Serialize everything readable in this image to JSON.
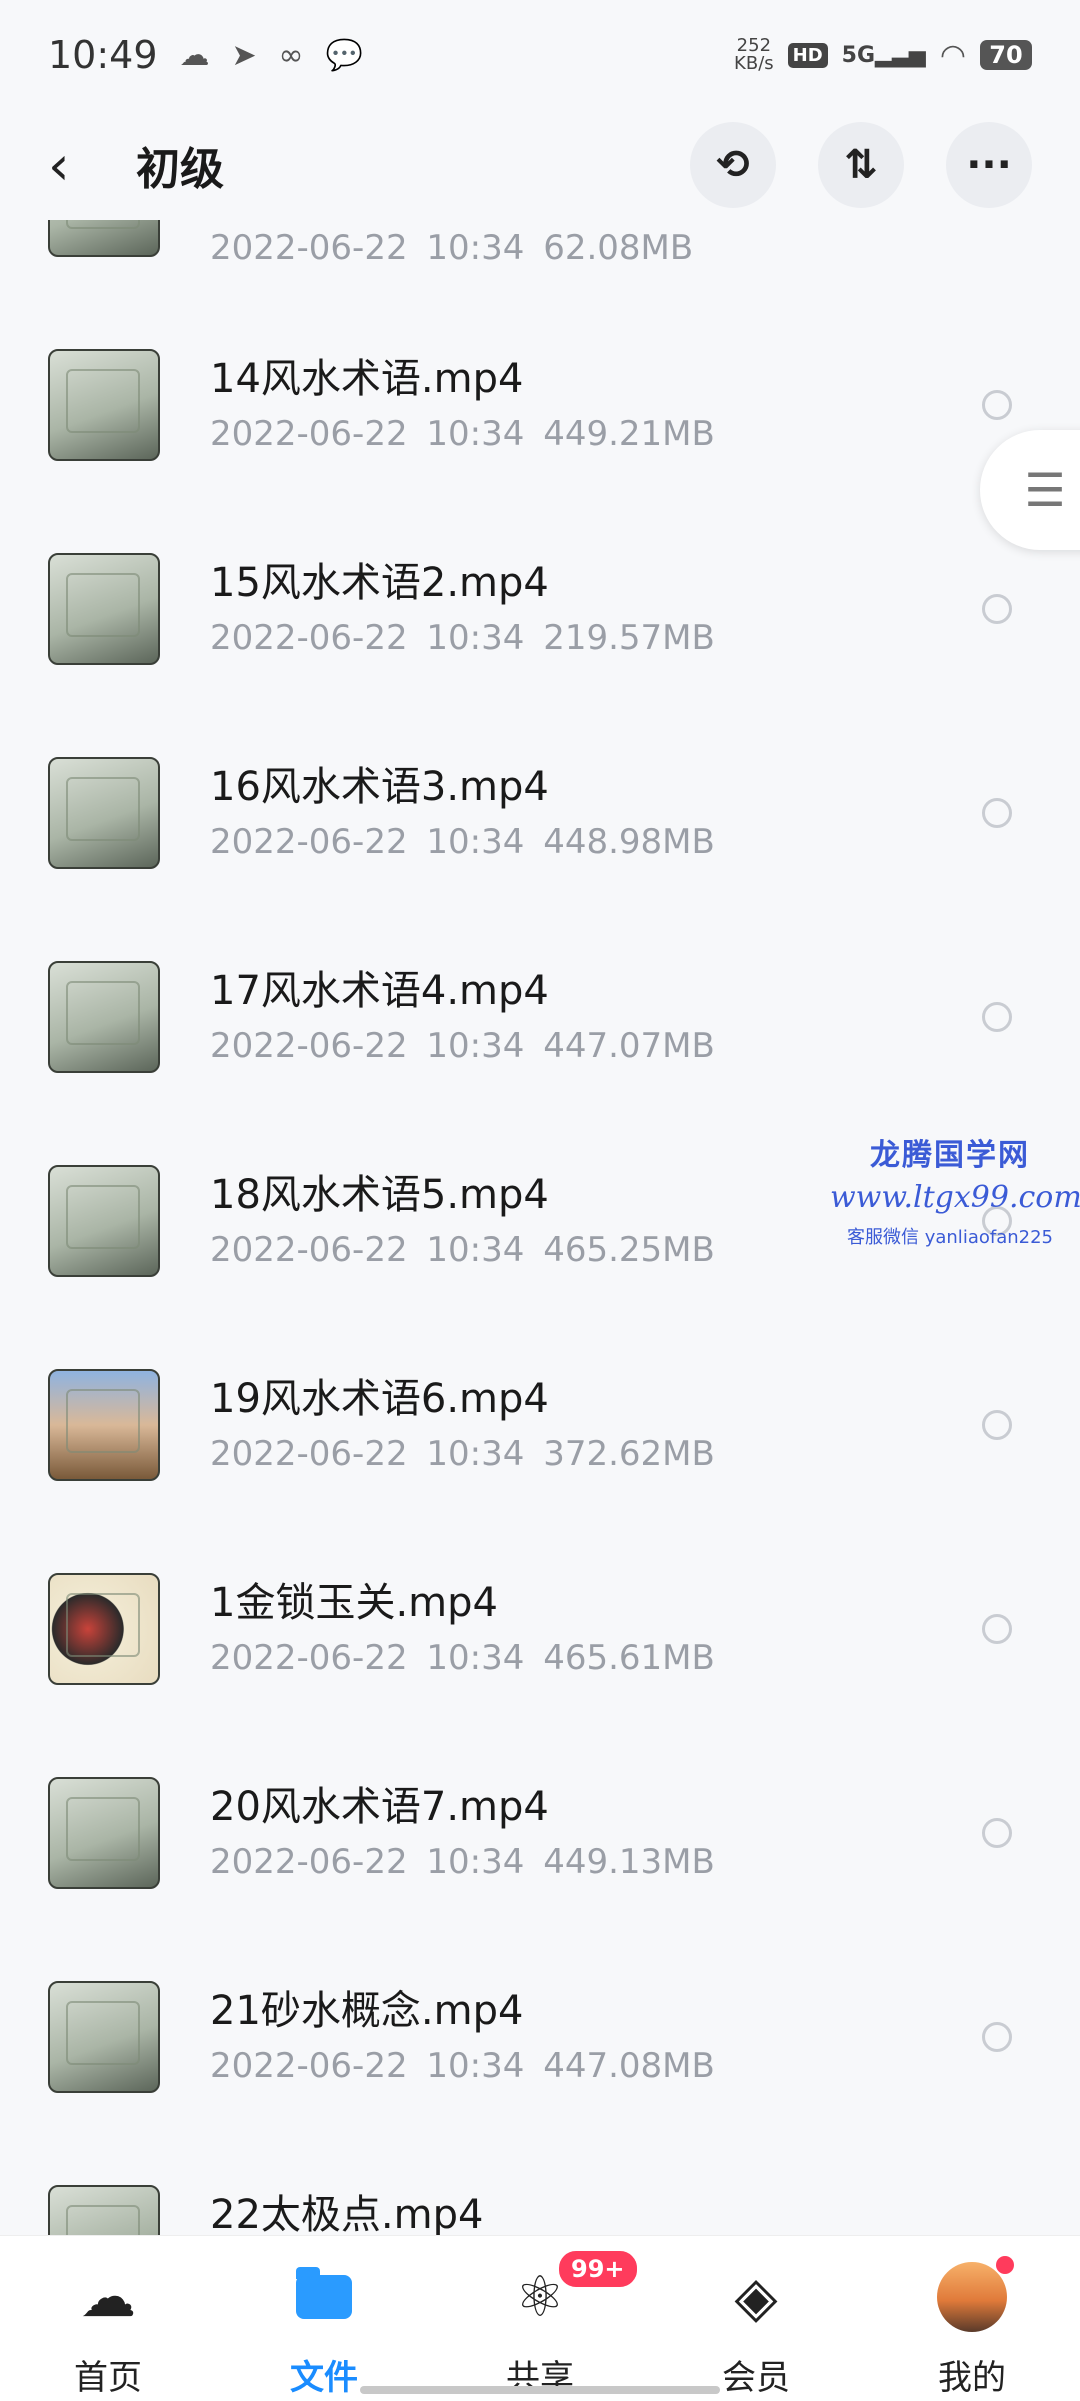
{
  "status_bar": {
    "time": "10:49",
    "net_speed_value": "252",
    "net_speed_unit": "KB/s",
    "hd": "HD",
    "network": "5G",
    "battery": "70"
  },
  "header": {
    "title": "初级"
  },
  "files": [
    {
      "name": "",
      "date": "2022-06-22",
      "time": "10:34",
      "size": "62.08MB"
    },
    {
      "name": "14风水术语.mp4",
      "date": "2022-06-22",
      "time": "10:34",
      "size": "449.21MB"
    },
    {
      "name": "15风水术语2.mp4",
      "date": "2022-06-22",
      "time": "10:34",
      "size": "219.57MB"
    },
    {
      "name": "16风水术语3.mp4",
      "date": "2022-06-22",
      "time": "10:34",
      "size": "448.98MB"
    },
    {
      "name": "17风水术语4.mp4",
      "date": "2022-06-22",
      "time": "10:34",
      "size": "447.07MB"
    },
    {
      "name": "18风水术语5.mp4",
      "date": "2022-06-22",
      "time": "10:34",
      "size": "465.25MB"
    },
    {
      "name": "19风水术语6.mp4",
      "date": "2022-06-22",
      "time": "10:34",
      "size": "372.62MB"
    },
    {
      "name": "1金锁玉关.mp4",
      "date": "2022-06-22",
      "time": "10:34",
      "size": "465.61MB"
    },
    {
      "name": "20风水术语7.mp4",
      "date": "2022-06-22",
      "time": "10:34",
      "size": "449.13MB"
    },
    {
      "name": "21砂水概念.mp4",
      "date": "2022-06-22",
      "time": "10:34",
      "size": "447.08MB"
    },
    {
      "name": "22太极点.mp4",
      "date": "",
      "time": "",
      "size": ""
    }
  ],
  "watermark": {
    "title": "龙腾国学网",
    "url": "www.ltgx99.com",
    "contact": "客服微信 yanliaofan225"
  },
  "bottom_nav": {
    "home": "首页",
    "files": "文件",
    "share": "共享",
    "share_badge": "99+",
    "vip": "会员",
    "mine": "我的"
  }
}
